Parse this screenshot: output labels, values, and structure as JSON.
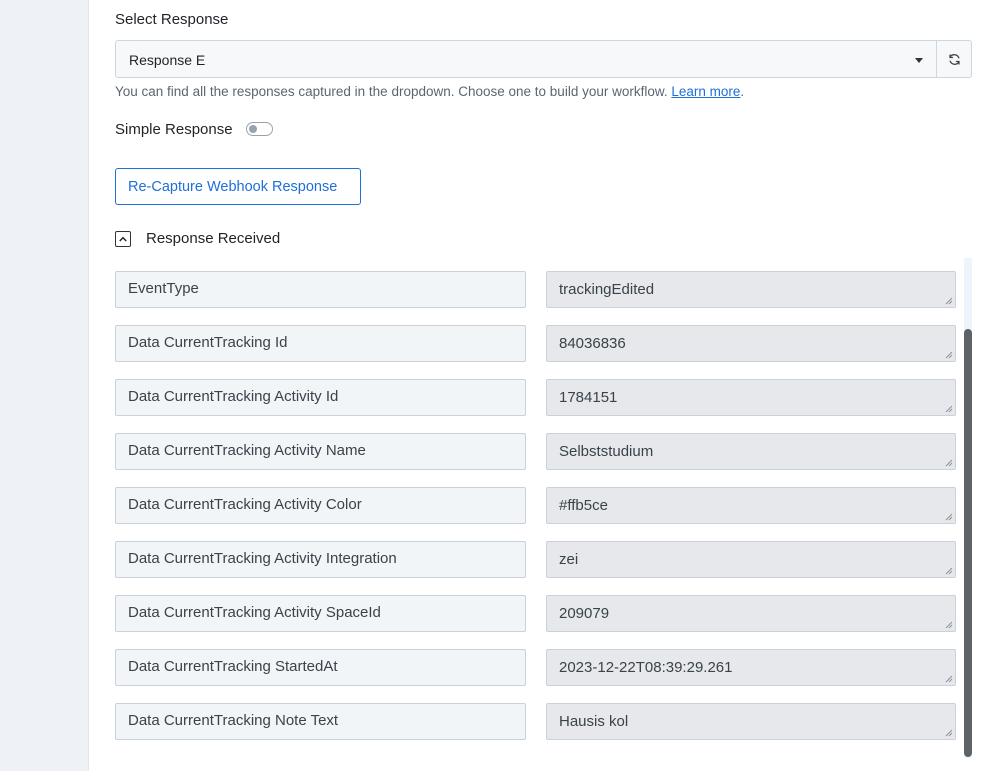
{
  "select_response": {
    "label": "Select Response",
    "selected": "Response E",
    "helper_text": "You can find all the responses captured in the dropdown. Choose one to build your workflow.",
    "learn_more": "Learn more",
    "helper_suffix": "."
  },
  "simple_response": {
    "label": "Simple Response",
    "enabled": false
  },
  "recapture_button": {
    "label": "Re-Capture Webhook Response"
  },
  "response_received": {
    "title": "Response Received",
    "expanded": true,
    "rows": [
      {
        "key": "EventType",
        "value": "trackingEdited"
      },
      {
        "key": "Data CurrentTracking Id",
        "value": "84036836"
      },
      {
        "key": "Data CurrentTracking Activity Id",
        "value": "1784151"
      },
      {
        "key": "Data CurrentTracking Activity Name",
        "value": "Selbststudium"
      },
      {
        "key": "Data CurrentTracking Activity Color",
        "value": "#ffb5ce"
      },
      {
        "key": "Data CurrentTracking Activity Integration",
        "value": "zei"
      },
      {
        "key": "Data CurrentTracking Activity SpaceId",
        "value": "209079"
      },
      {
        "key": "Data CurrentTracking StartedAt",
        "value": "2023-12-22T08:39:29.261"
      },
      {
        "key": "Data CurrentTracking Note Text",
        "value": "Hausis kol"
      }
    ]
  },
  "colors": {
    "accent": "#1d6fd9",
    "key_background": "#f2f5f8",
    "value_background": "#e6e8eb",
    "scrollbar_thumb": "#5e6368"
  },
  "icons": {
    "dropdown": "caret-down-icon",
    "refresh": "refresh-icon",
    "collapse": "chevron-up-icon"
  }
}
